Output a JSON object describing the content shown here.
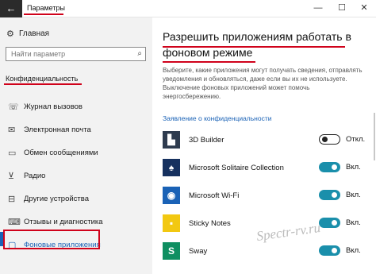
{
  "window": {
    "title": "Параметры",
    "back_icon": "arrow-left-icon",
    "minimize": "—",
    "maximize": "☐",
    "close": "✕"
  },
  "sidebar": {
    "home_label": "Главная",
    "search_placeholder": "Найти параметр",
    "section_title": "Конфиденциальность",
    "items": [
      {
        "label": "Журнал вызовов",
        "icon": "call-history-icon",
        "glyph": "☏"
      },
      {
        "label": "Электронная почта",
        "icon": "mail-icon",
        "glyph": "✉"
      },
      {
        "label": "Обмен сообщениями",
        "icon": "messaging-icon",
        "glyph": "▭"
      },
      {
        "label": "Радио",
        "icon": "radio-icon",
        "glyph": "⊻"
      },
      {
        "label": "Другие устройства",
        "icon": "devices-icon",
        "glyph": "⊟"
      },
      {
        "label": "Отзывы и диагностика",
        "icon": "feedback-icon",
        "glyph": "⌨"
      },
      {
        "label": "Фоновые приложения",
        "icon": "background-apps-icon",
        "glyph": "▢"
      }
    ],
    "active_index": 6
  },
  "main": {
    "heading": "Разрешить приложениям работать в фоновом режиме",
    "description": "Выберите, какие приложения могут получать сведения, отправлять уведомления и обновляться, даже если вы их не используете. Выключение фоновых приложений может помочь энергосбережению.",
    "privacy_link": "Заявление о конфиденциальности",
    "apps": [
      {
        "name": "3D Builder",
        "state_label": "Откл.",
        "on": false,
        "icon_color": "#2e3b4e",
        "glyph": "▙"
      },
      {
        "name": "Microsoft Solitaire Collection",
        "state_label": "Вкл.",
        "on": true,
        "icon_color": "#16315f",
        "glyph": "♠"
      },
      {
        "name": "Microsoft Wi-Fi",
        "state_label": "Вкл.",
        "on": true,
        "icon_color": "#1a62b6",
        "glyph": "◉"
      },
      {
        "name": "Sticky Notes",
        "state_label": "Вкл.",
        "on": true,
        "icon_color": "#f2c811",
        "glyph": "▪"
      },
      {
        "name": "Sway",
        "state_label": "Вкл.",
        "on": true,
        "icon_color": "#0f8f61",
        "glyph": "S"
      }
    ]
  },
  "watermark": "Spectr-rv.ru",
  "colors": {
    "accent": "#1a62b6",
    "toggle_on": "#1a8fab",
    "highlight": "#d0021b"
  }
}
